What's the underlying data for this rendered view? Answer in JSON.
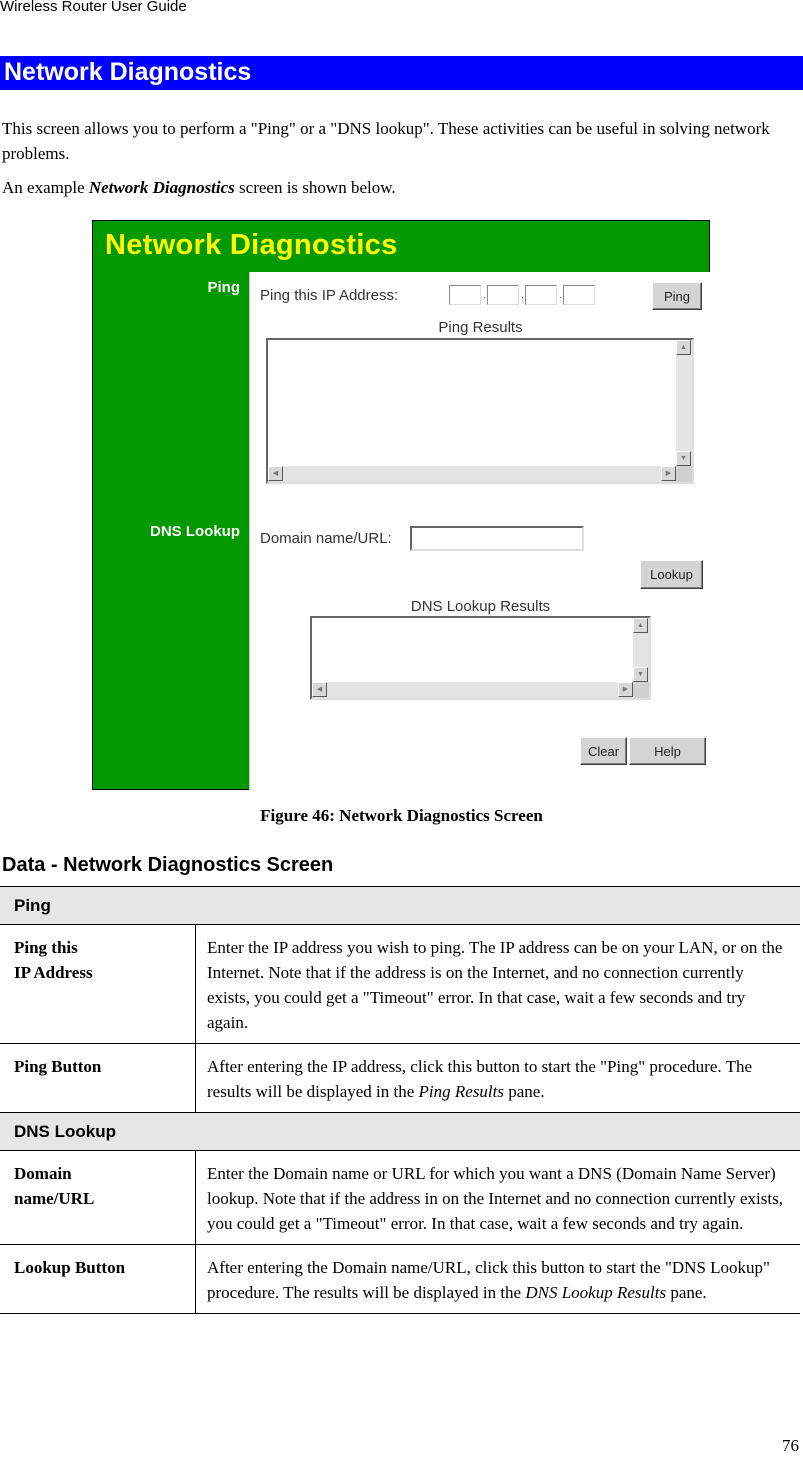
{
  "header": {
    "running_title": "Wireless Router User Guide"
  },
  "section": {
    "title": "Network Diagnostics"
  },
  "intro": {
    "paragraph": "This screen allows you to perform a \"Ping\" or a \"DNS lookup\". These activities can be useful in solving network problems.",
    "example_prefix": "An example ",
    "example_emphasis": "Network Diagnostics",
    "example_suffix": " screen is shown below."
  },
  "screenshot": {
    "title": "Network Diagnostics",
    "colors": {
      "background": "#009900",
      "title": "#ffff00",
      "panel": "#ffffff"
    },
    "ping": {
      "side_label": "Ping",
      "ip_label": "Ping this IP Address:",
      "ip_octets": [
        "",
        "",
        "",
        ""
      ],
      "ping_button": "Ping",
      "results_label": "Ping Results",
      "results_value": ""
    },
    "dns": {
      "side_label": "DNS Lookup",
      "domain_label": "Domain name/URL:",
      "domain_value": "",
      "lookup_button": "Lookup",
      "results_label": "DNS Lookup Results",
      "results_value": ""
    },
    "clear_button": "Clear",
    "help_button": "Help",
    "scroll_icons": {
      "up": "▲",
      "down": "▼",
      "left": "◀",
      "right": "▶"
    }
  },
  "figure_caption": "Figure 46: Network Diagnostics Screen",
  "data_heading": "Data - Network Diagnostics Screen",
  "table": {
    "groups": [
      {
        "title": "Ping",
        "rows": [
          {
            "term_line1": "Ping this",
            "term_line2": "IP Address",
            "desc": "Enter the IP address you wish to ping. The IP address can be on your LAN, or on the Internet. Note that if the address is on the Internet, and no connection currently exists, you could get a \"Timeout\" error. In that case, wait a few seconds and try again."
          },
          {
            "term_line1": "Ping Button",
            "desc_prefix": "After entering the IP address, click this button to start the \"Ping\" procedure. The results will be displayed in the ",
            "desc_emphasis": "Ping Results",
            "desc_suffix": " pane."
          }
        ]
      },
      {
        "title": "DNS Lookup",
        "rows": [
          {
            "term_line1": "Domain",
            "term_line2": "name/URL",
            "desc": "Enter the Domain name or URL for which you want a DNS (Domain Name Server) lookup. Note that if the address in on the Internet and no connection currently exists, you could get a \"Timeout\" error. In that case, wait a few seconds and try again."
          },
          {
            "term_line1": "Lookup Button",
            "desc_prefix": "After entering the Domain name/URL, click this button to start the \"DNS Lookup\" procedure. The results will be displayed in the ",
            "desc_emphasis": "DNS Lookup Results",
            "desc_suffix": " pane."
          }
        ]
      }
    ]
  },
  "page_number": "76"
}
